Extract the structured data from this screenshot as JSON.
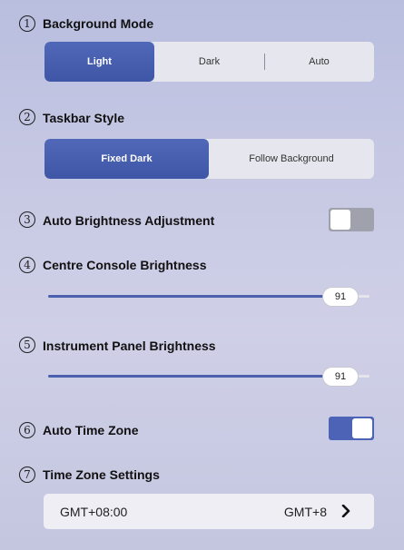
{
  "background_mode": {
    "number": "1",
    "title": "Background Mode",
    "options": [
      "Light",
      "Dark",
      "Auto"
    ],
    "selected": "Light"
  },
  "taskbar_style": {
    "number": "2",
    "title": "Taskbar Style",
    "options": [
      "Fixed Dark",
      "Follow Background"
    ],
    "selected": "Fixed Dark"
  },
  "auto_brightness": {
    "number": "3",
    "title": "Auto Brightness Adjustment",
    "enabled": false
  },
  "centre_console": {
    "number": "4",
    "title": "Centre Console Brightness",
    "value": "91",
    "fraction": 0.91
  },
  "instrument_panel": {
    "number": "5",
    "title": "Instrument Panel Brightness",
    "value": "91",
    "fraction": 0.91
  },
  "auto_time_zone": {
    "number": "6",
    "title": "Auto Time Zone",
    "enabled": true
  },
  "time_zone_settings": {
    "number": "7",
    "title": "Time Zone Settings",
    "value_left": "GMT+08:00",
    "value_right": "GMT+8",
    "icon": "chevron-right-icon"
  },
  "colors": {
    "accent": "#4d63b5",
    "toggle_off": "#9fa2ac",
    "panel": "#e6e6ef"
  }
}
